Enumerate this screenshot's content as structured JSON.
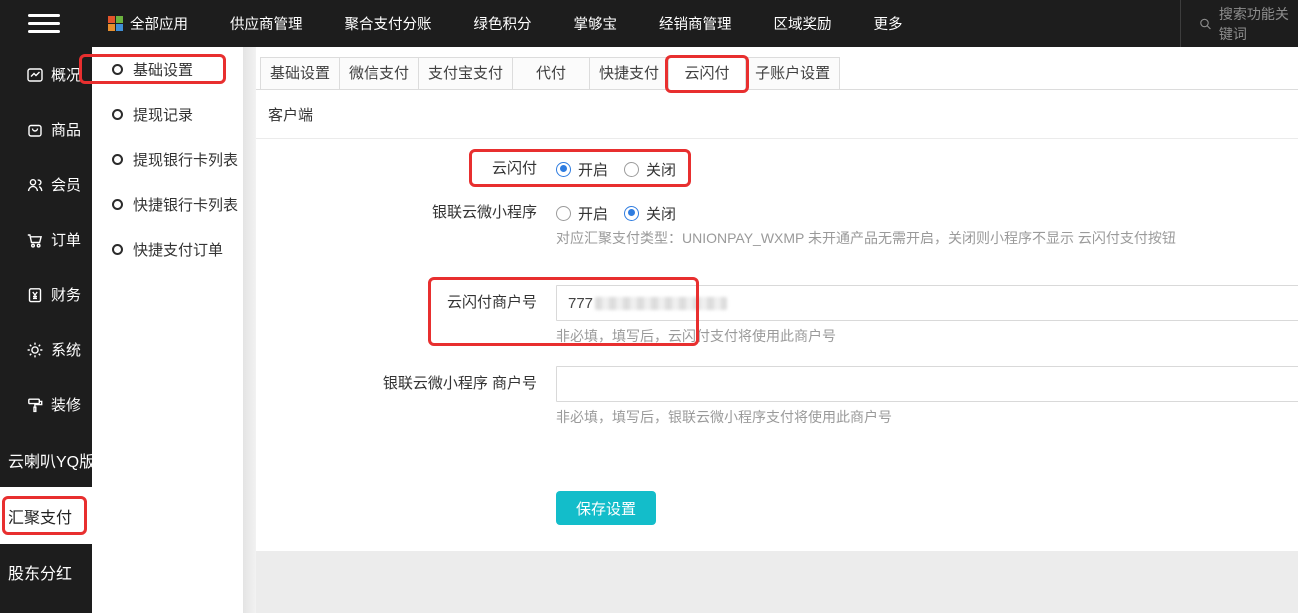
{
  "topbar": {
    "nav": [
      "全部应用",
      "供应商管理",
      "聚合支付分账",
      "绿色积分",
      "掌够宝",
      "经销商管理",
      "区域奖励",
      "更多"
    ],
    "search_placeholder": "搜索功能关键词"
  },
  "sidebar": {
    "items": [
      {
        "label": "概况"
      },
      {
        "label": "商品"
      },
      {
        "label": "会员"
      },
      {
        "label": "订单"
      },
      {
        "label": "财务"
      },
      {
        "label": "系统"
      },
      {
        "label": "装修"
      },
      {
        "label": "云喇叭YQ版"
      },
      {
        "label": "汇聚支付",
        "active": true
      },
      {
        "label": "股东分红"
      }
    ]
  },
  "submenu": {
    "items": [
      {
        "label": "基础设置",
        "highlighted": true
      },
      {
        "label": "提现记录"
      },
      {
        "label": "提现银行卡列表"
      },
      {
        "label": "快捷银行卡列表"
      },
      {
        "label": "快捷支付订单"
      }
    ]
  },
  "main": {
    "tabs": [
      {
        "label": "基础设置"
      },
      {
        "label": "微信支付"
      },
      {
        "label": "支付宝支付"
      },
      {
        "label": "代付"
      },
      {
        "label": "快捷支付"
      },
      {
        "label": "云闪付",
        "active": true
      },
      {
        "label": "子账户设置"
      }
    ],
    "section_title": "客户端",
    "form": {
      "quickpass": {
        "label": "云闪付",
        "option_on": "开启",
        "option_off": "关闭",
        "selected": "开启"
      },
      "miniprogram": {
        "label": "银联云微小程序",
        "option_on": "开启",
        "option_off": "关闭",
        "selected": "关闭",
        "help": "对应汇聚支付类型：UNIONPAY_WXMP 未开通产品无需开启，关闭则小程序不显示 云闪付支付按钮"
      },
      "merchant_no": {
        "label": "云闪付商户号",
        "value_visible": "777",
        "value_redacted": true,
        "help": "非必填，填写后，云闪付支付将使用此商户号"
      },
      "mp_merchant_no": {
        "label": "银联云微小程序 商户号",
        "value": "",
        "help": "非必填，填写后，银联云微小程序支付将使用此商户号"
      },
      "save_label": "保存设置"
    }
  },
  "colors": {
    "topbar_bg": "#1d1d1d",
    "accent_teal": "#13bdca",
    "radio_blue": "#2e7ce0",
    "annotation_red": "#e82f2f"
  }
}
